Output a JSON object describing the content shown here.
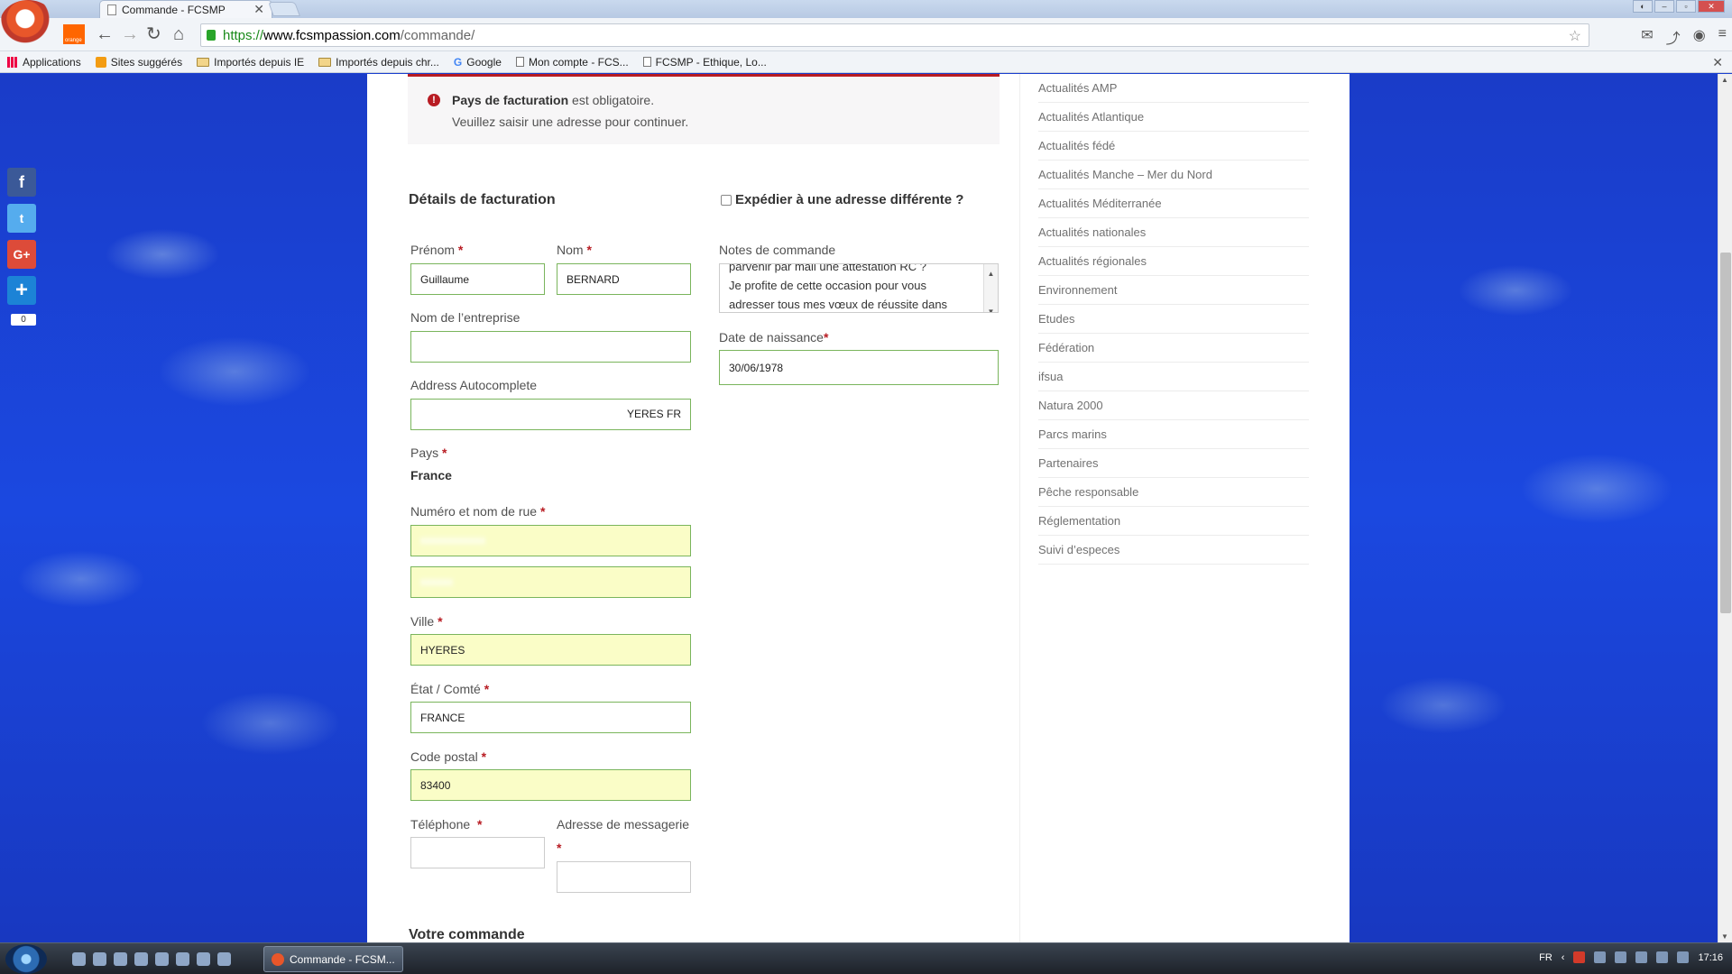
{
  "browser": {
    "tab_title": "Commande - FCSMP",
    "url_scheme": "https://",
    "url_host": "www.fcsmpassion.com",
    "url_path": "/commande/",
    "orange_logo_text": "orange"
  },
  "bookmarks": [
    {
      "label": "Applications",
      "icon": "apps-icon"
    },
    {
      "label": "Sites suggérés",
      "icon": "suggested-icon"
    },
    {
      "label": "Importés depuis IE",
      "icon": "folder-icon"
    },
    {
      "label": "Importés depuis chr...",
      "icon": "folder-icon"
    },
    {
      "label": "Google",
      "icon": "google-icon"
    },
    {
      "label": "Mon compte - FCS...",
      "icon": "page-icon"
    },
    {
      "label": "FCSMP - Ethique, Lo...",
      "icon": "page-icon"
    }
  ],
  "error": {
    "field": "Pays de facturation",
    "message": " est obligatoire.",
    "hint": "Veuillez saisir une adresse pour continuer."
  },
  "billing": {
    "title": "Détails de facturation",
    "first_name_label": "Prénom",
    "first_name_value": "Guillaume",
    "last_name_label": "Nom",
    "last_name_value": "BERNARD",
    "company_label": "Nom de l’entreprise",
    "autocomplete_label": "Address Autocomplete",
    "autocomplete_visible": "YERES FR",
    "country_label": "Pays",
    "country_value": "France",
    "street_label": "Numéro et nom de rue",
    "city_label": "Ville",
    "city_value": "HYERES",
    "state_label": "État / Comté",
    "state_value": "FRANCE",
    "postcode_label": "Code postal",
    "postcode_value": "83400",
    "phone_label": "Téléphone",
    "email_label": "Adresse de messagerie",
    "required_mark": "*"
  },
  "shipping": {
    "ship_different_label": "Expédier à une adresse différente ?",
    "notes_label": "Notes de commande",
    "notes_lines": [
      "parvenir par mail une attestation RC ?",
      "Je profite de cette occasion pour vous",
      "adresser tous mes vœux de réussite dans"
    ],
    "dob_label": "Date de naissance",
    "dob_value": "30/06/1978"
  },
  "order_title": "Votre commande",
  "sidebar": {
    "items": [
      "Actualités AMP",
      "Actualités Atlantique",
      "Actualités fédé",
      "Actualités Manche – Mer du Nord",
      "Actualités Méditerranée",
      "Actualités nationales",
      "Actualités régionales",
      "Environnement",
      "Etudes",
      "Fédération",
      "ifsua",
      "Natura 2000",
      "Parcs marins",
      "Partenaires",
      "Pêche responsable",
      "Réglementation",
      "Suivi d’especes"
    ]
  },
  "social": {
    "share_count": "0",
    "colors": {
      "facebook": "#3b5998",
      "twitter": "#55acee",
      "googleplus": "#dd4b39",
      "addthis": "#1c83d6"
    }
  },
  "taskbar": {
    "task_label": "Commande - FCSM...",
    "lang": "FR",
    "time": "17:16"
  },
  "colors": {
    "error_red": "#b81c23",
    "field_green": "#7ab55c",
    "autofill_yellow": "#fafdc7"
  }
}
